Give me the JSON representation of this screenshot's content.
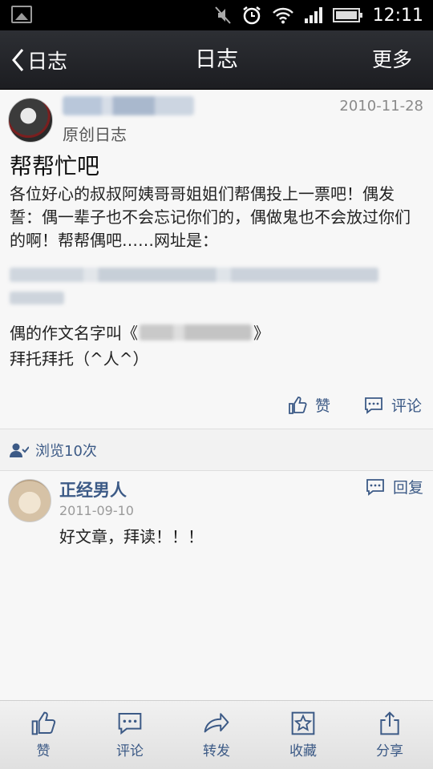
{
  "status_bar": {
    "time": "12:11"
  },
  "nav": {
    "back_label": "日志",
    "title": "日志",
    "more_label": "更多"
  },
  "post": {
    "date": "2010-11-28",
    "type": "原创日志",
    "title": "帮帮忙吧",
    "body": "各位好心的叔叔阿姨哥哥姐姐们帮偶投上一票吧！偶发誓：偶一辈子也不会忘记你们的，偶做鬼也不会放过你们的啊！帮帮偶吧……网址是：",
    "essay_prefix": "偶的作文名字叫《",
    "essay_suffix": "》",
    "thanks": "拜托拜托（^人^）",
    "like_label": "赞",
    "comment_label": "评论"
  },
  "views": {
    "text": "浏览10次"
  },
  "comment": {
    "author": "正经男人",
    "date": "2011-09-10",
    "text": "好文章，拜读！！！",
    "reply_label": "回复"
  },
  "bottom_bar": {
    "tabs": [
      {
        "label": "赞",
        "icon": "thumbs-up-icon"
      },
      {
        "label": "评论",
        "icon": "comment-icon"
      },
      {
        "label": "转发",
        "icon": "forward-icon"
      },
      {
        "label": "收藏",
        "icon": "star-icon"
      },
      {
        "label": "分享",
        "icon": "share-icon"
      }
    ]
  },
  "colors": {
    "accent": "#3c5a86",
    "nav_bg": "#1c1d21",
    "date_gray": "#8a8a8a"
  }
}
